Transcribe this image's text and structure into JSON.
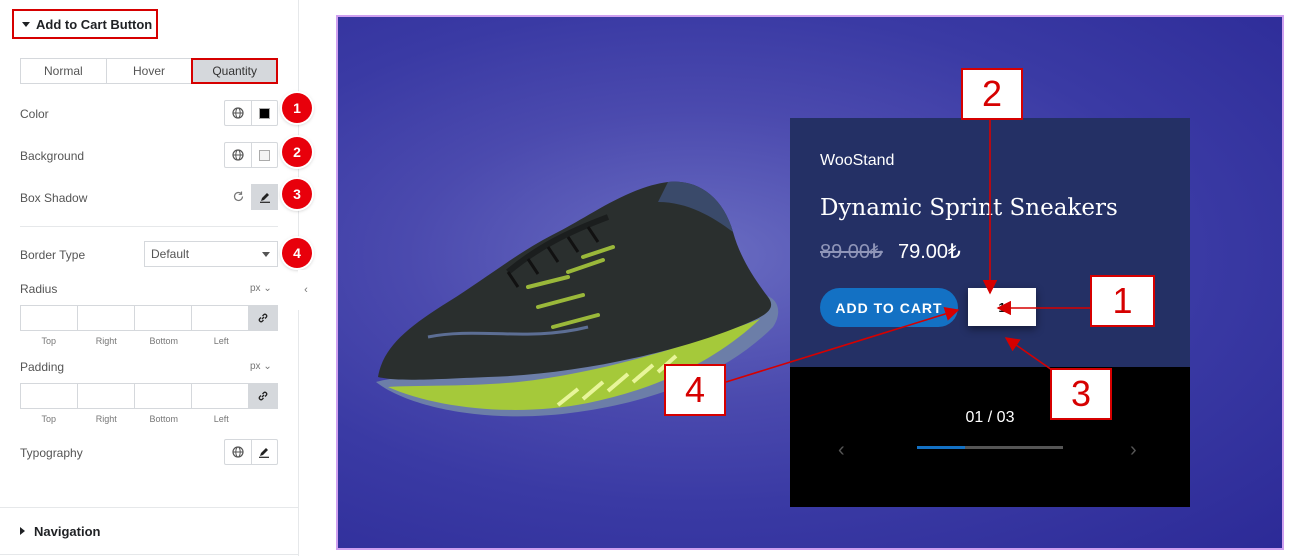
{
  "panel": {
    "section_title": "Add to Cart Button",
    "tabs": [
      {
        "label": "Normal"
      },
      {
        "label": "Hover"
      },
      {
        "label": "Quantity"
      }
    ],
    "active_tab": "Quantity",
    "rows": {
      "color_label": "Color",
      "background_label": "Background",
      "box_shadow_label": "Box Shadow",
      "border_type_label": "Border Type",
      "border_type_value": "Default",
      "radius_label": "Radius",
      "padding_label": "Padding",
      "typography_label": "Typography",
      "unit": "px",
      "dim_labels": [
        "Top",
        "Right",
        "Bottom",
        "Left"
      ]
    },
    "swatch_colors": {
      "color": "#000000",
      "background": "#f3f3f3"
    },
    "badges": [
      "1",
      "2",
      "3",
      "4"
    ],
    "navigation_label": "Navigation"
  },
  "preview": {
    "brand": "WooStand",
    "product_title": "Dynamic Sprint Sneakers",
    "old_price": "89.00₺",
    "new_price": "79.00₺",
    "add_to_cart_label": "ADD TO CART",
    "quantity_value": "1",
    "slide_counter": "01 / 03",
    "slide_progress": 0.33,
    "prev_icon": "chevron-left-icon",
    "next_icon": "chevron-right-icon"
  },
  "annotations": [
    "1",
    "2",
    "3",
    "4"
  ],
  "colors": {
    "accent_red": "#d60000",
    "button_blue": "#1371c4",
    "card_navy": "#243065",
    "preview_border": "#cfa0f0"
  }
}
